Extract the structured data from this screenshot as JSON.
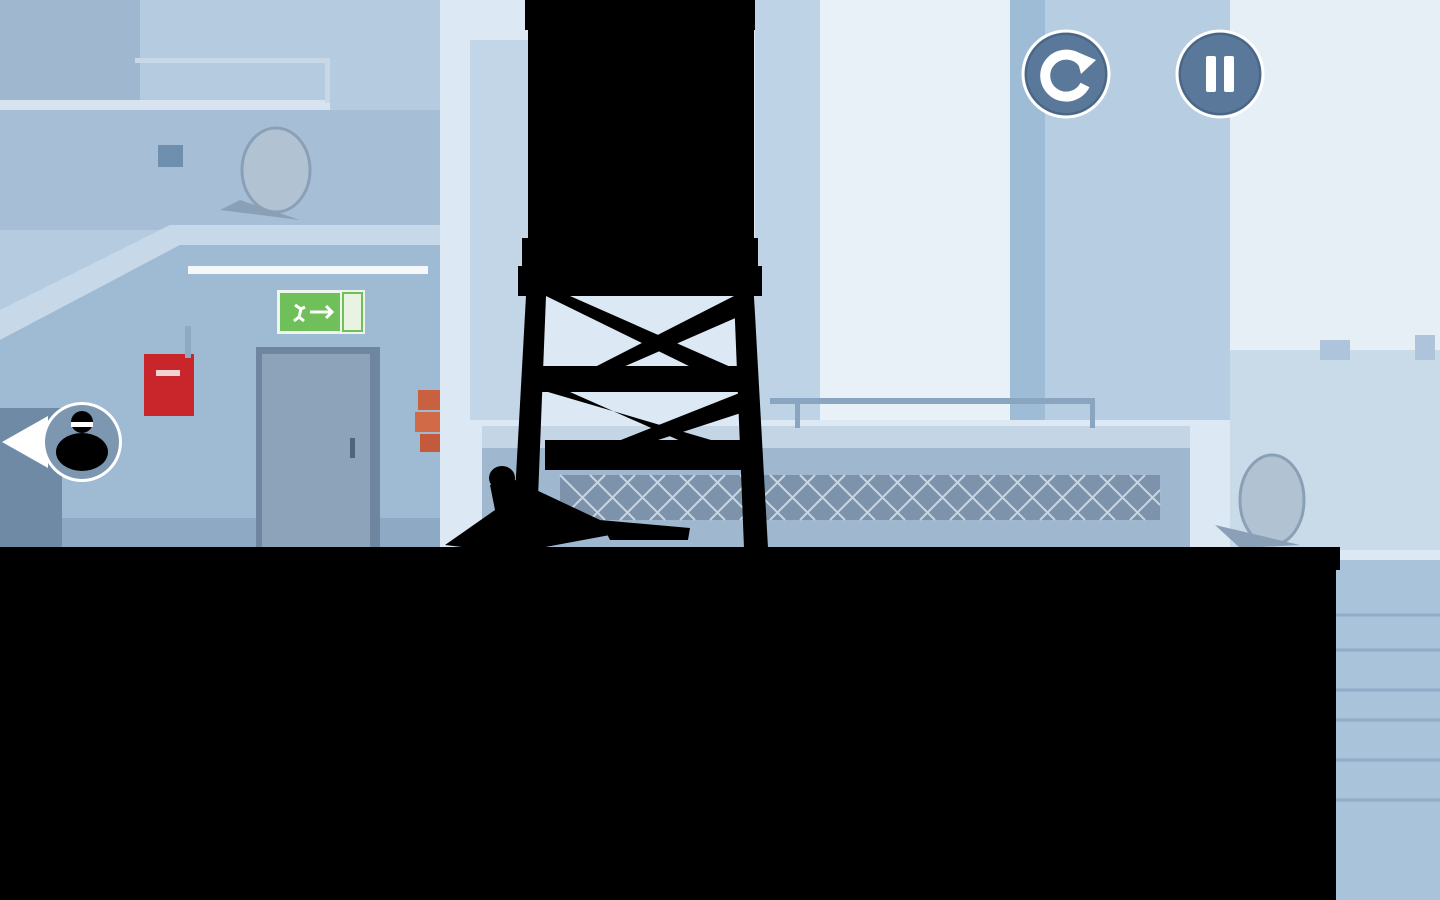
{
  "hud": {
    "restart_button": {
      "icon": "restart-icon"
    },
    "pause_button": {
      "icon": "pause-icon"
    },
    "chaser_indicator": {
      "icon": "hunter-silhouette-icon",
      "direction": "left"
    }
  },
  "colors": {
    "sky": "#dce8f4",
    "building_light": "#cfe0ef",
    "building_mid": "#9fbcd6",
    "building_dark": "#6e8fb0",
    "silhouette": "#000000",
    "hud_button_fill": "#5a7899",
    "hud_button_ring": "#ffffff",
    "exit_sign_green": "#6fbf5a",
    "alarm_box_red": "#c8262b"
  }
}
